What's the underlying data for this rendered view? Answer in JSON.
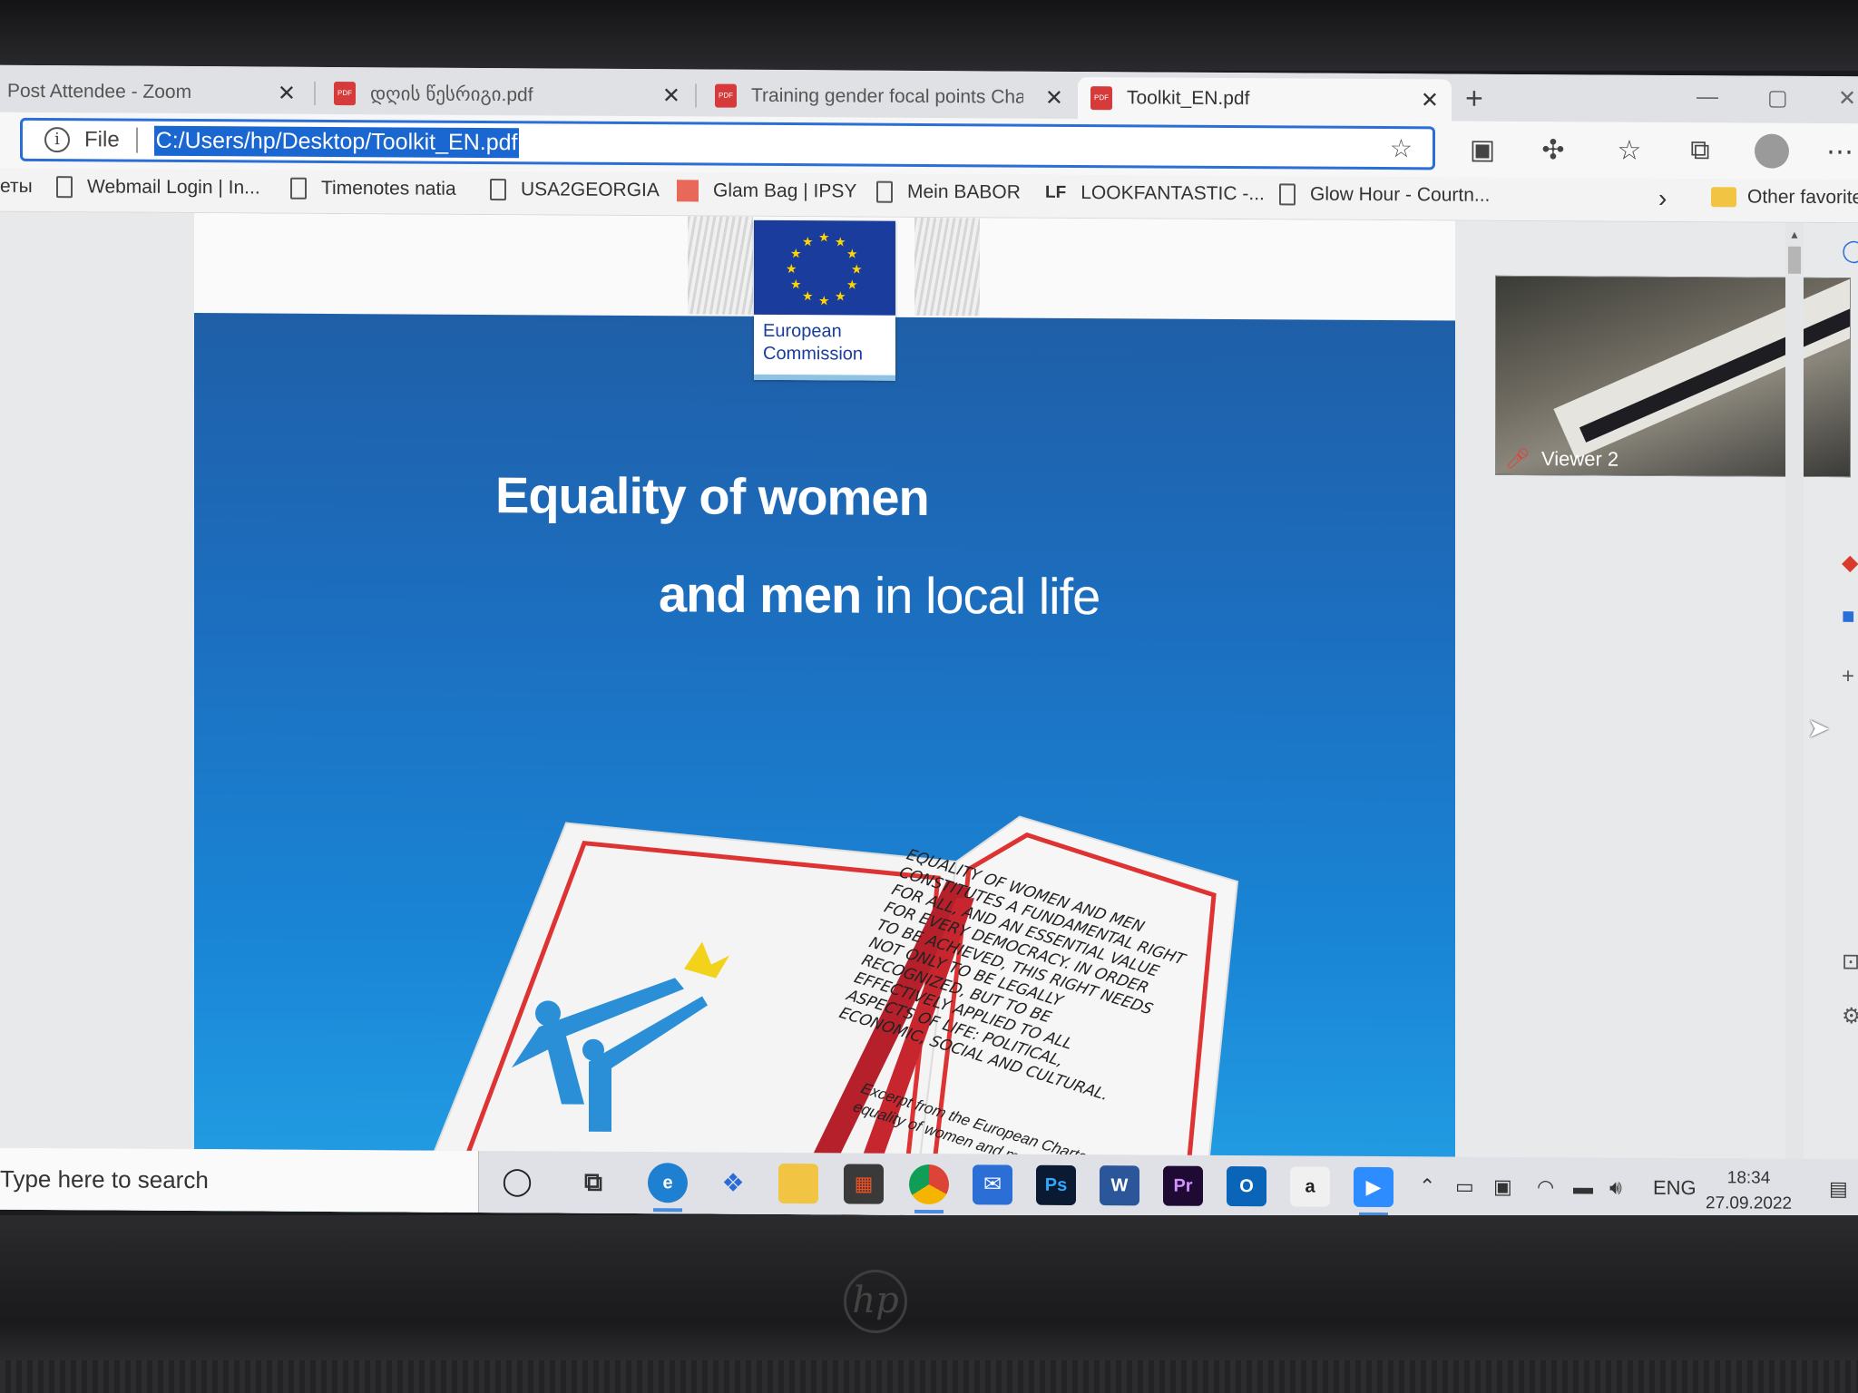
{
  "tabs": [
    {
      "label": "Post Attendee - Zoom",
      "close": "✕"
    },
    {
      "label": "დღის წესრიგი.pdf",
      "close": "✕"
    },
    {
      "label": "Training gender focal points Cha",
      "close": "✕"
    },
    {
      "label": "Toolkit_EN.pdf",
      "close": "✕"
    }
  ],
  "new_tab": "+",
  "address": {
    "file_label": "File",
    "url": "C:/Users/hp/Desktop/Toolkit_EN.pdf"
  },
  "bookmarks": [
    {
      "label": "еты"
    },
    {
      "label": "Webmail Login | In..."
    },
    {
      "label": "Timenotes natia"
    },
    {
      "label": "USA2GEORGIA"
    },
    {
      "label": "Glam Bag | IPSY"
    },
    {
      "label": "Mein BABOR"
    },
    {
      "label": "LOOKFANTASTIC -...",
      "prefix": "LF"
    },
    {
      "label": "Glow Hour - Courtn..."
    },
    {
      "label": "Other favorite"
    }
  ],
  "pdf": {
    "logo_line1": "European",
    "logo_line2": "Commission",
    "title_line1": "Equality of women",
    "title_line2_bold": "and men",
    "title_line2_rest": " in local life",
    "book_text": "Equality of women and men constitutes a fundamental right for all, and an essential value for every democracy. In order to be achieved, this right needs not only to be legally recognized, but to be effectively applied to all aspects of life: political, economic, social and cultural.",
    "book_excerpt": "Excerpt from the European Charter for equality of women and men in local life"
  },
  "video": {
    "participant": "Viewer 2"
  },
  "taskbar": {
    "search_placeholder": "Type here to search",
    "apps": [
      "cortana",
      "task-view",
      "edge",
      "dropbox",
      "file-explorer",
      "microsoft-store",
      "chrome",
      "mail",
      "photoshop",
      "word",
      "premiere",
      "outlook",
      "amazon",
      "zoom"
    ],
    "app_labels": {
      "ps": "Ps",
      "word": "W",
      "premiere": "Pr",
      "outlook": "O",
      "amazon": "a"
    },
    "language": "ENG",
    "time": "18:34",
    "date": "27.09.2022"
  },
  "colors": {
    "accent": "#2b6fd6",
    "pdf_blue": "#1c6fc0",
    "eu_blue": "#1a3c9c",
    "eu_yellow": "#ffd400",
    "book_red": "#c8262f"
  }
}
